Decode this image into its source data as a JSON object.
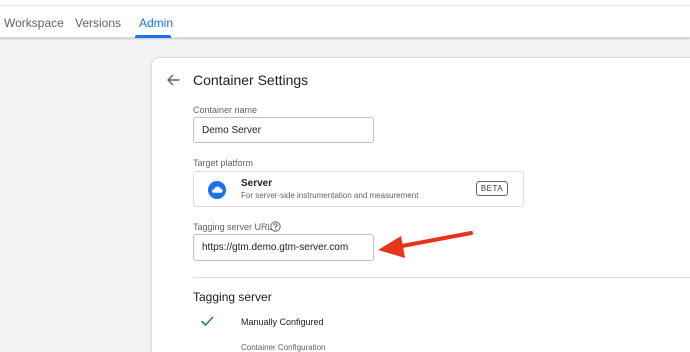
{
  "nav": {
    "tabs": [
      {
        "label": "Workspace",
        "active": false
      },
      {
        "label": "Versions",
        "active": false
      },
      {
        "label": "Admin",
        "active": true
      }
    ]
  },
  "page": {
    "title": "Container Settings",
    "back_icon": "arrow-back-icon"
  },
  "form": {
    "container_name": {
      "label": "Container name",
      "value": "Demo Server"
    },
    "target_platform": {
      "label": "Target platform",
      "name": "Server",
      "description": "For server-side instrumentation and measurement",
      "badge": "BETA",
      "icon": "cloud-icon"
    },
    "tagging_server_url": {
      "label": "Tagging server URL",
      "value": "https://gtm.demo.gtm-server.com",
      "help_icon": "help-icon"
    }
  },
  "tagging_server": {
    "title": "Tagging server",
    "status": "Manually Configured",
    "status_icon": "check-icon",
    "config_label": "Container Configuration"
  },
  "colors": {
    "accent": "#1a73e8",
    "success": "#1e8e3e",
    "annotation_arrow": "#e8341c",
    "cloud": "#1a73e8"
  }
}
